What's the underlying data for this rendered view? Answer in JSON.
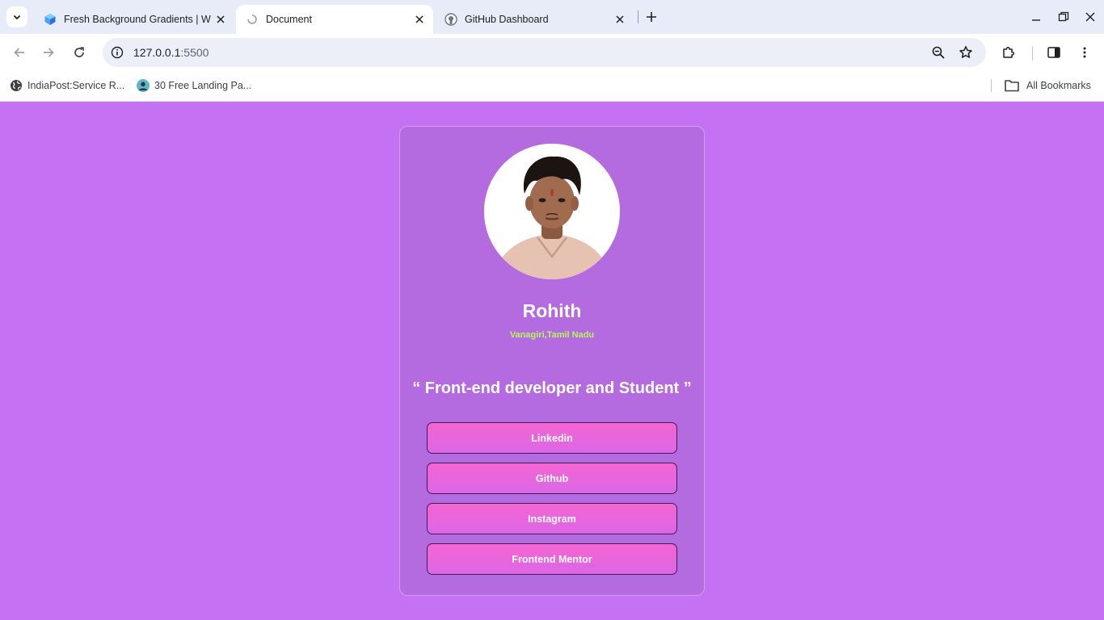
{
  "browser": {
    "tabs": [
      {
        "title": "Fresh Background Gradients | W",
        "favicon": "webgradients-icon",
        "active": false
      },
      {
        "title": "Document",
        "favicon": "loading-icon",
        "active": true
      },
      {
        "title": "GitHub Dashboard",
        "favicon": "github-icon",
        "active": false
      }
    ],
    "address_bar": {
      "host": "127.0.0.1",
      "port": ":5500"
    },
    "bookmarks": [
      {
        "label": "IndiaPost:Service R...",
        "icon": "globe-icon"
      },
      {
        "label": "30 Free Landing Pa...",
        "icon": "avatar-icon"
      }
    ],
    "all_bookmarks_label": "All Bookmarks"
  },
  "profile": {
    "name": "Rohith",
    "location": "Vanagiri,Tamil Nadu",
    "quote": "“ Front-end developer and Student ”",
    "links": [
      {
        "label": "Linkedin"
      },
      {
        "label": "Github"
      },
      {
        "label": "Instagram"
      },
      {
        "label": "Frontend Mentor"
      }
    ]
  },
  "colors": {
    "page_background": "#c471f3",
    "card_background": "#b46be0",
    "location_text": "#b9f55a",
    "button_gradient_top": "#f465d2",
    "button_gradient_bottom": "#dc66e6"
  }
}
